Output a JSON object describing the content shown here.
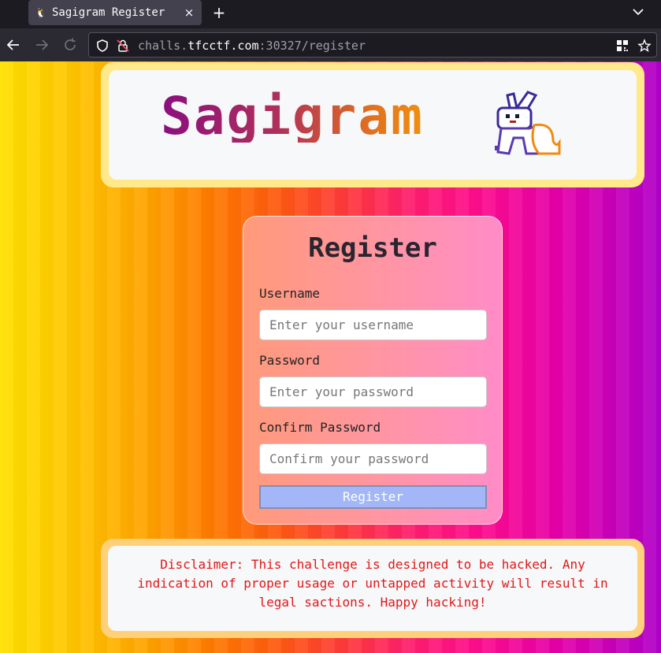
{
  "browser": {
    "tab_title": "Sagigram Register",
    "tab_close": "×",
    "new_tab": "+",
    "url_scheme_host_prefix": "challs.",
    "url_host": "tfcctf.com",
    "url_rest": ":30327/register"
  },
  "header": {
    "logo_text": "Sagigram",
    "logo_icon": "pixel-bunny-icon"
  },
  "form": {
    "title": "Register",
    "username_label": "Username",
    "username_placeholder": "Enter your username",
    "password_label": "Password",
    "password_placeholder": "Enter your password",
    "confirm_label": "Confirm Password",
    "confirm_placeholder": "Confirm your password",
    "submit_label": "Register"
  },
  "disclaimer": {
    "text": "Disclaimer: This challenge is designed to be hacked. Any indication of proper usage or untapped activity will result in legal sactions. Happy hacking!"
  },
  "colors": {
    "accent_button": "#a2b6f8",
    "disclaimer_text": "#e01818",
    "logo_frame": "#ffe98a",
    "disclaimer_frame": "#ffd07a"
  }
}
